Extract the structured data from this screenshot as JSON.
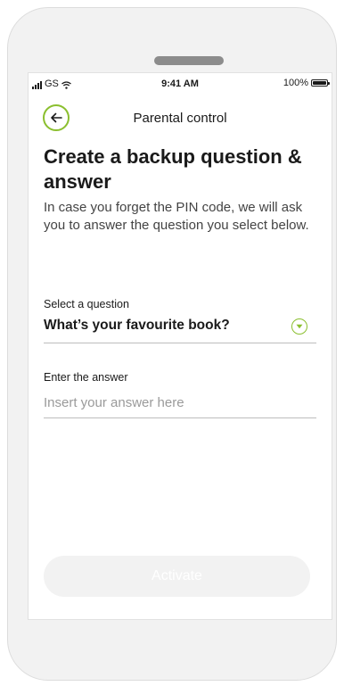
{
  "status_bar": {
    "carrier": "GS",
    "time": "9:41 AM",
    "battery_text": "100%",
    "battery_level": 1.0
  },
  "header": {
    "back_icon": "arrow-left-icon",
    "title": "Parental control"
  },
  "main": {
    "heading": "Create a backup question & answer",
    "description": "In case you forget the PIN code, we will ask you to answer the question you select below.",
    "question": {
      "label": "Select a question",
      "value": "What’s your favourite book?",
      "icon": "chevron-down-icon"
    },
    "answer": {
      "label": "Enter the answer",
      "value": "",
      "placeholder": "Insert your answer here"
    },
    "activate_label": "Activate"
  },
  "colors": {
    "accent": "#8bbf2f",
    "disabled_button": "#f2f2f2",
    "text": "#1a1a1a",
    "muted": "#9a9a9a"
  }
}
